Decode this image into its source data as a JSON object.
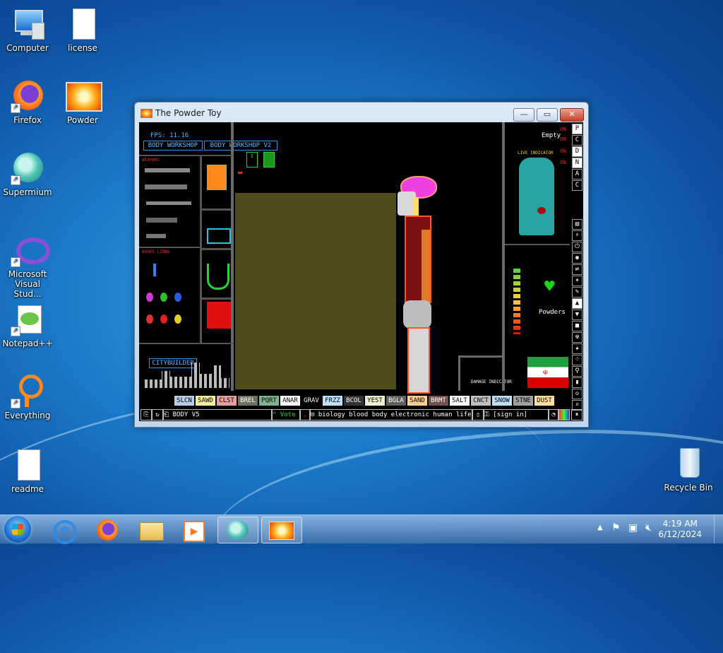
{
  "desktop": {
    "icons": [
      {
        "label": "Computer"
      },
      {
        "label": "license"
      },
      {
        "label": "Firefox"
      },
      {
        "label": "Powder"
      },
      {
        "label": "Supermium"
      },
      {
        "label": "Microsoft Visual Stud..."
      },
      {
        "label": "Notepad++"
      },
      {
        "label": "Everything"
      },
      {
        "label": "readme"
      },
      {
        "label": "Recycle Bin"
      }
    ]
  },
  "window": {
    "title": "The Powder Toy",
    "minimize": "—",
    "maximize": "▭",
    "close": "✕"
  },
  "game": {
    "fps": "FPS: 11.16",
    "tags": [
      "BODY WORKSHOP",
      "BODY WORKSHOP V2"
    ],
    "weapons_label": "WEAPONS",
    "bones_label": "BONES LIMBS",
    "citybuilder": "CITYBUILDER",
    "empty": "Empty",
    "live_indicator": "LIVE INDICATOR",
    "damage_indicator": "DAMAGE INDICATOR",
    "powders": "Powders",
    "on_labels": [
      "ON",
      "ON",
      "ON",
      "ON"
    ],
    "side_letters": [
      "P",
      "C",
      "D",
      "N",
      "A",
      "C"
    ],
    "elements": [
      {
        "name": "SLCN",
        "color": "#b8cce6"
      },
      {
        "name": "SAWD",
        "color": "#f0f0a0"
      },
      {
        "name": "CLST",
        "color": "#e4a0a0"
      },
      {
        "name": "BREL",
        "color": "#707060"
      },
      {
        "name": "PQRT",
        "color": "#80b090"
      },
      {
        "name": "ANAR",
        "color": "#ffffff"
      },
      {
        "name": "GRAV",
        "color": "#000000"
      },
      {
        "name": "FRZZ",
        "color": "#c0e0ff"
      },
      {
        "name": "BCOL",
        "color": "#333333"
      },
      {
        "name": "YEST",
        "color": "#eeeed0"
      },
      {
        "name": "BGLA",
        "color": "#606060"
      },
      {
        "name": "SAND",
        "color": "#ffd090"
      },
      {
        "name": "BRMT",
        "color": "#705050"
      },
      {
        "name": "SALT",
        "color": "#ffffff"
      },
      {
        "name": "CNCT",
        "color": "#c0c0c0"
      },
      {
        "name": "SNOW",
        "color": "#c0e0ff"
      },
      {
        "name": "STNE",
        "color": "#a0a0a0"
      },
      {
        "name": "DUST",
        "color": "#ffe0a0"
      }
    ],
    "save_name": "BODY V5",
    "vote": "Vote",
    "tags_text": "biology blood body electronic human life...",
    "sign_in": "[sign in]"
  },
  "taskbar": {
    "time": "4:19 AM",
    "date": "6/12/2024"
  }
}
